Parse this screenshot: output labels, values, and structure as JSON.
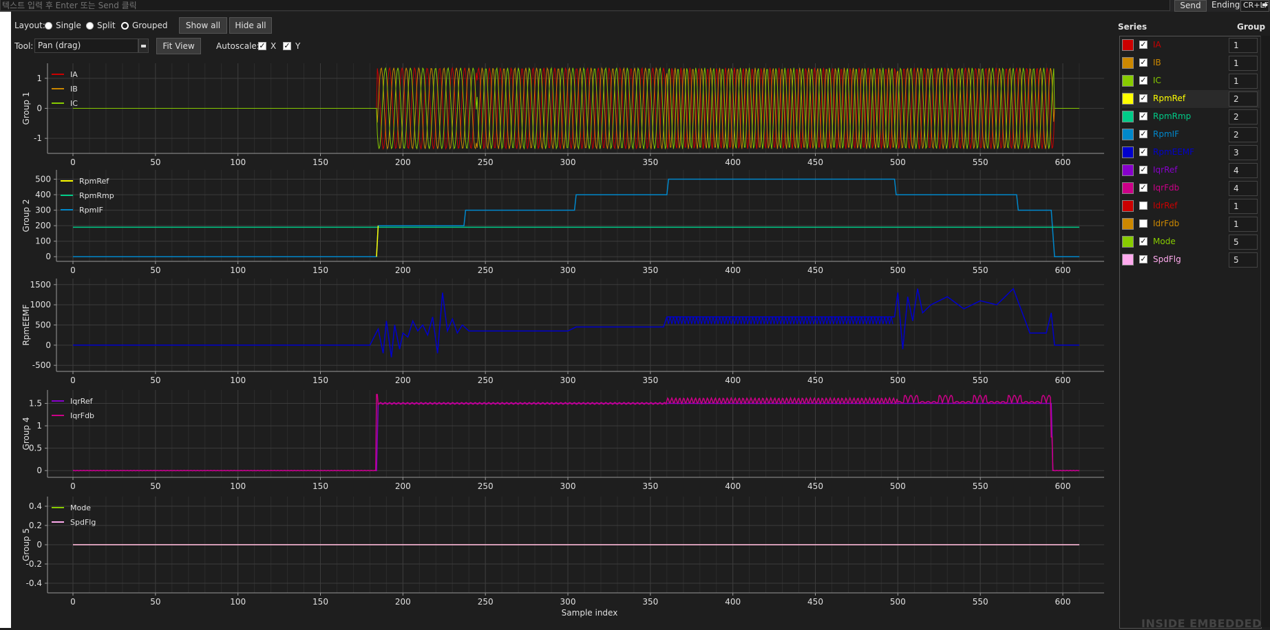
{
  "serial": {
    "placeholder": "텍스트 입력 후 Enter 또는 Send 클릭",
    "send_label": "Send",
    "ending_label": "Ending",
    "ending_value": "CR+LF"
  },
  "toolbar": {
    "layout_label": "Layout:",
    "layout_options": [
      "Single",
      "Split",
      "Grouped"
    ],
    "layout_selected": "Grouped",
    "show_all": "Show all",
    "hide_all": "Hide all",
    "tool_label": "Tool:",
    "tool_value": "Pan (drag)",
    "fit_view": "Fit View",
    "autoscale_label": "Autoscale:",
    "autoscale_x": "X",
    "autoscale_y": "Y"
  },
  "series_panel": {
    "title": "Series",
    "group_header": "Group",
    "items": [
      {
        "name": "IA",
        "color": "#cc0000",
        "checked": true,
        "group": "1"
      },
      {
        "name": "IB",
        "color": "#cc8800",
        "checked": true,
        "group": "1"
      },
      {
        "name": "IC",
        "color": "#88cc00",
        "checked": true,
        "group": "1"
      },
      {
        "name": "RpmRef",
        "color": "#ffff00",
        "checked": true,
        "group": "2"
      },
      {
        "name": "RpmRmp",
        "color": "#00cc88",
        "checked": true,
        "group": "2"
      },
      {
        "name": "RpmIF",
        "color": "#0088cc",
        "checked": true,
        "group": "2"
      },
      {
        "name": "RpmEEMF",
        "color": "#0000cc",
        "checked": true,
        "group": "3"
      },
      {
        "name": "IqrRef",
        "color": "#8800cc",
        "checked": true,
        "group": "4"
      },
      {
        "name": "IqrFdb",
        "color": "#cc0088",
        "checked": true,
        "group": "4"
      },
      {
        "name": "IdrRef",
        "color": "#cc0000",
        "checked": false,
        "group": "1"
      },
      {
        "name": "IdrFdb",
        "color": "#cc8800",
        "checked": false,
        "group": "1"
      },
      {
        "name": "Mode",
        "color": "#88cc00",
        "checked": true,
        "group": "5"
      },
      {
        "name": "SpdFlg",
        "color": "#ffaaee",
        "checked": true,
        "group": "5"
      }
    ]
  },
  "watermark": "INSIDE EMBEDDED",
  "chart_data": [
    {
      "type": "line",
      "ylabel": "Group 1",
      "xlim": [
        0,
        610
      ],
      "ylim": [
        -1.5,
        1.5
      ],
      "xticks": [
        "0",
        "50",
        "100",
        "150",
        "200",
        "250",
        "300",
        "350",
        "400",
        "450",
        "500",
        "550",
        "600"
      ],
      "yticks": [
        "-1",
        "0",
        "1"
      ],
      "ytick_values": [
        -1,
        0,
        1
      ],
      "legend": [
        "IA",
        "IB",
        "IC"
      ],
      "legend_colors": [
        "#cc0000",
        "#cc8800",
        "#88cc00"
      ],
      "series": [
        {
          "name": "IA",
          "color": "#cc0000",
          "description": "0 until ~184, then sinusoid amplitude ~1.35 until ~595, then 0"
        },
        {
          "name": "IB",
          "color": "#cc8800",
          "description": "0 until ~184, then sinusoid amplitude ~1.35 until ~595, then 0"
        },
        {
          "name": "IC",
          "color": "#88cc00",
          "description": "0 until ~184, then sinusoid amplitude ~1.35 until ~595, then 0"
        }
      ]
    },
    {
      "type": "line",
      "ylabel": "Group 2",
      "xlim": [
        0,
        610
      ],
      "ylim": [
        -30,
        560
      ],
      "xticks": [
        "0",
        "50",
        "100",
        "150",
        "200",
        "250",
        "300",
        "350",
        "400",
        "450",
        "500",
        "550",
        "600"
      ],
      "yticks": [
        "0",
        "100",
        "200",
        "300",
        "400",
        "500"
      ],
      "ytick_values": [
        0,
        100,
        200,
        300,
        400,
        500
      ],
      "legend": [
        "RpmRef",
        "RpmRmp",
        "RpmIF"
      ],
      "legend_colors": [
        "#ffff00",
        "#00cc88",
        "#0088cc"
      ],
      "series": [
        {
          "name": "RpmIF",
          "color": "#0088cc",
          "x": [
            0,
            184,
            185,
            237,
            238,
            304,
            305,
            360,
            361,
            498,
            499,
            572,
            573,
            593,
            595,
            610
          ],
          "y": [
            0,
            0,
            200,
            200,
            300,
            300,
            400,
            400,
            500,
            500,
            400,
            400,
            300,
            300,
            0,
            0
          ]
        },
        {
          "name": "RpmRmp",
          "color": "#00cc88",
          "x": [
            0,
            610
          ],
          "y": [
            190,
            190
          ]
        },
        {
          "name": "RpmRef",
          "color": "#ffff00",
          "x": [
            184,
            185
          ],
          "y": [
            0,
            200
          ]
        }
      ]
    },
    {
      "type": "line",
      "ylabel": "RpmEEMF",
      "xlim": [
        0,
        610
      ],
      "ylim": [
        -650,
        1650
      ],
      "xticks": [
        "0",
        "50",
        "100",
        "150",
        "200",
        "250",
        "300",
        "350",
        "400",
        "450",
        "500",
        "550",
        "600"
      ],
      "yticks": [
        "-500",
        "0",
        "500",
        "1000",
        "1500"
      ],
      "ytick_values": [
        -500,
        0,
        500,
        1000,
        1500
      ],
      "legend": [],
      "legend_colors": [],
      "series": [
        {
          "name": "RpmEEMF",
          "color": "#0000cc",
          "x": [
            0,
            180,
            185,
            188,
            190,
            193,
            195,
            198,
            200,
            203,
            206,
            209,
            212,
            215,
            218,
            221,
            224,
            227,
            230,
            233,
            236,
            240,
            300,
            305,
            358,
            360,
            498,
            500,
            503,
            506,
            509,
            512,
            515,
            520,
            530,
            540,
            550,
            560,
            570,
            580,
            590,
            593,
            595,
            610
          ],
          "y": [
            0,
            0,
            400,
            -200,
            600,
            -300,
            500,
            -100,
            300,
            200,
            600,
            350,
            500,
            250,
            700,
            -200,
            1300,
            350,
            650,
            300,
            500,
            350,
            350,
            450,
            450,
            700,
            700,
            1300,
            -100,
            1200,
            600,
            1400,
            800,
            1000,
            1200,
            900,
            1100,
            1000,
            1400,
            300,
            300,
            800,
            0,
            0
          ]
        }
      ]
    },
    {
      "type": "line",
      "ylabel": "Group 4",
      "xlim": [
        0,
        610
      ],
      "ylim": [
        -0.15,
        1.8
      ],
      "xticks": [
        "0",
        "50",
        "100",
        "150",
        "200",
        "250",
        "300",
        "350",
        "400",
        "450",
        "500",
        "550",
        "600"
      ],
      "yticks": [
        "0",
        "0.5",
        "1",
        "1.5"
      ],
      "ytick_values": [
        0,
        0.5,
        1,
        1.5
      ],
      "legend": [
        "IqrRef",
        "IqrFdb"
      ],
      "legend_colors": [
        "#8800cc",
        "#cc0088"
      ],
      "series": [
        {
          "name": "IqrRef",
          "color": "#8800cc",
          "x": [
            0,
            184,
            185,
            593,
            594,
            610
          ],
          "y": [
            0,
            0,
            1.5,
            1.5,
            0,
            0
          ]
        },
        {
          "name": "IqrFdb",
          "color": "#cc0088",
          "x": [
            0,
            184,
            185,
            186,
            360,
            500,
            520,
            560,
            590,
            593,
            594,
            610
          ],
          "y": [
            0,
            0,
            1.7,
            1.5,
            1.5,
            1.6,
            1.65,
            1.7,
            1.5,
            1.5,
            0,
            0
          ]
        }
      ]
    },
    {
      "type": "line",
      "ylabel": "Group 5",
      "xlabel": "Sample index",
      "xlim": [
        0,
        610
      ],
      "ylim": [
        -0.5,
        0.5
      ],
      "xticks": [
        "0",
        "50",
        "100",
        "150",
        "200",
        "250",
        "300",
        "350",
        "400",
        "450",
        "500",
        "550",
        "600"
      ],
      "yticks": [
        "-0.4",
        "-0.2",
        "0",
        "0.2",
        "0.4"
      ],
      "ytick_values": [
        -0.4,
        -0.2,
        0,
        0.2,
        0.4
      ],
      "legend": [
        "Mode",
        "SpdFlg"
      ],
      "legend_colors": [
        "#88cc00",
        "#ffaaee"
      ],
      "series": [
        {
          "name": "Mode",
          "color": "#88cc00",
          "x": [
            0,
            610
          ],
          "y": [
            0,
            0
          ]
        },
        {
          "name": "SpdFlg",
          "color": "#ffaaee",
          "x": [
            0,
            610
          ],
          "y": [
            0,
            0
          ]
        }
      ]
    }
  ]
}
